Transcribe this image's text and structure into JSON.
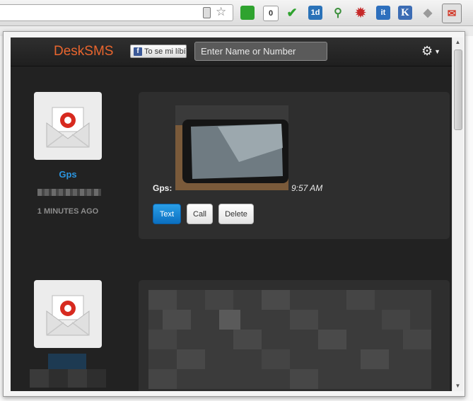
{
  "browser": {
    "extensions": [
      {
        "name": "page-action",
        "color": "#2fa32f",
        "glyph": ""
      },
      {
        "name": "counter",
        "color": "#ffffff",
        "glyph": "0"
      },
      {
        "name": "check",
        "color": "#2fa32f",
        "glyph": "✔"
      },
      {
        "name": "calendar",
        "color": "#2a72b8",
        "glyph": "1d"
      },
      {
        "name": "tree",
        "color": "#3b8f3b",
        "glyph": "⚲"
      },
      {
        "name": "bug",
        "color": "#c62828",
        "glyph": "✹"
      },
      {
        "name": "it",
        "color": "#2d6fbd",
        "glyph": "it"
      },
      {
        "name": "k",
        "color": "#3c6cb4",
        "glyph": "K"
      },
      {
        "name": "diamond",
        "color": "#9a9a9a",
        "glyph": "◆"
      },
      {
        "name": "desksms",
        "color": "#d23a2a",
        "glyph": "✉"
      }
    ]
  },
  "header": {
    "brand": "DeskSMS",
    "facebook_label": "To se mi líbí",
    "search_placeholder": "Enter Name or Number",
    "settings_icon": "gear-icon"
  },
  "conversations": [
    {
      "name": "Gps",
      "time_ago": "1 MINUTES AGO",
      "sender": "Gps:",
      "time": "9:57 AM",
      "buttons": {
        "text": "Text",
        "call": "Call",
        "delete": "Delete"
      }
    }
  ],
  "colors": {
    "brand": "#e8652e",
    "contact_name": "#2b95e0",
    "primary_button": "#0b6fc0"
  }
}
